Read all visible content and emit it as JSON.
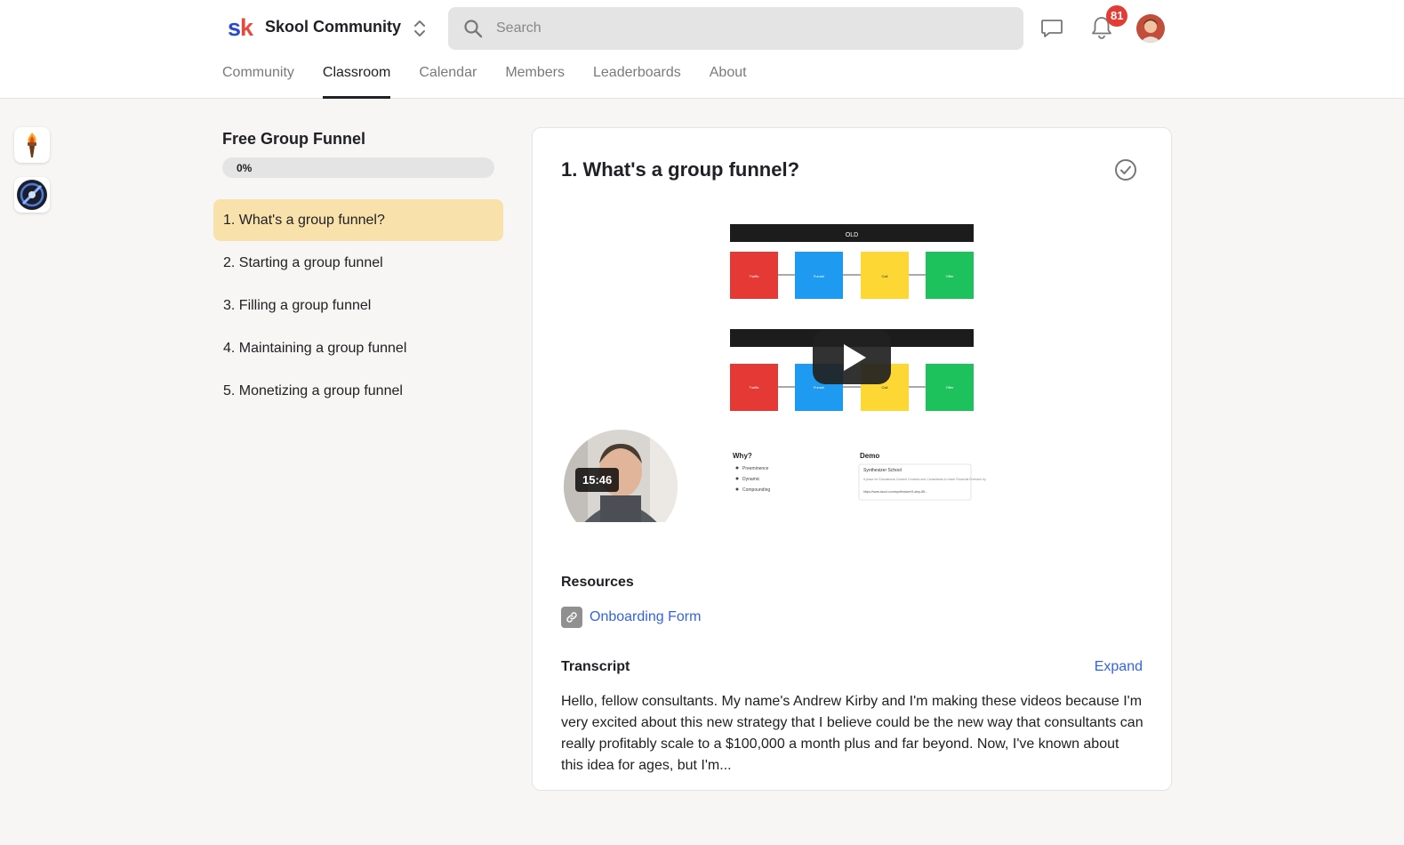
{
  "header": {
    "community_name": "Skool Community",
    "search_placeholder": "Search",
    "notification_count": "81",
    "brand_colors": {
      "s": "#2b4cc9",
      "k": "#e54b3c"
    }
  },
  "nav": {
    "tabs": [
      {
        "label": "Community"
      },
      {
        "label": "Classroom",
        "active": true
      },
      {
        "label": "Calendar"
      },
      {
        "label": "Members"
      },
      {
        "label": "Leaderboards"
      },
      {
        "label": "About"
      }
    ]
  },
  "rail": {
    "items": [
      "torch-icon",
      "compass-icon"
    ]
  },
  "course": {
    "title": "Free Group Funnel",
    "progress_label": "0%",
    "progress": 0,
    "lessons": [
      {
        "label": "1. What's a group funnel?",
        "active": true
      },
      {
        "label": "2. Starting a group funnel"
      },
      {
        "label": "3. Filling a group funnel"
      },
      {
        "label": "4. Maintaining a group funnel"
      },
      {
        "label": "5. Monetizing a group funnel"
      }
    ]
  },
  "lesson": {
    "title": "1. What's a group funnel?",
    "video": {
      "duration": "15:46",
      "slide": {
        "old_label": "OLD",
        "row1": [
          "Traffic",
          "Funnel",
          "Call",
          "Offer"
        ],
        "row2": [
          "Traffic",
          "Funnel",
          "Call",
          "Offer"
        ],
        "why_title": "Why?",
        "why_items": [
          "Preeminence",
          "Dynamic",
          "Compounding"
        ],
        "demo_title": "Demo",
        "demo_card_title": "Synthesizer School",
        "demo_card_text": "A place for Educational Content Creators and Consultants to reach Financial Freedom by",
        "demo_card_url": "https://www.skool.com/synthesizer/9-step-88..."
      }
    },
    "resources_title": "Resources",
    "resource_label": "Onboarding Form",
    "transcript_title": "Transcript",
    "expand_label": "Expand",
    "transcript_text": "Hello, fellow consultants. My name's Andrew Kirby and I'm making these videos because I'm very excited about this new strategy that I believe could be the new way that consultants can really profitably scale to a $100,000 a month plus and far beyond. Now, I've known about this idea for ages, but I'm..."
  }
}
